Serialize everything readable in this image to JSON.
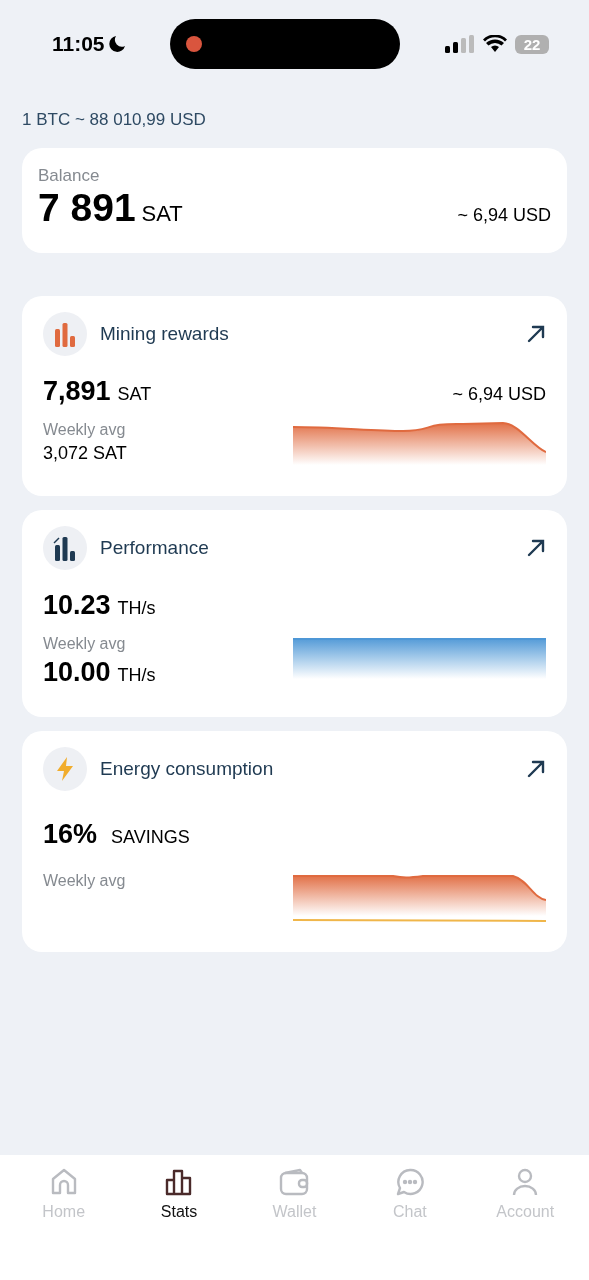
{
  "status_bar": {
    "time": "11:05",
    "battery": "22"
  },
  "rate": "1 BTC ~ 88 010,99 USD",
  "balance": {
    "label": "Balance",
    "value": "7 891",
    "unit": "SAT",
    "fiat": "~ 6,94 USD"
  },
  "cards": [
    {
      "kind": "rewards",
      "title": "Mining rewards",
      "value": "7,891",
      "unit": "SAT",
      "fiat": "~ 6,94 USD",
      "avg_label": "Weekly avg",
      "avg_value": "3,072 SAT"
    },
    {
      "kind": "performance",
      "title": "Performance",
      "value": "10.23",
      "unit": "TH/s",
      "avg_label": "Weekly avg",
      "avg_value": "10.00",
      "avg_unit": "TH/s"
    },
    {
      "kind": "energy",
      "title": "Energy consumption",
      "value": "16%",
      "unit": "SAVINGS",
      "avg_label": "Weekly avg"
    }
  ],
  "nav": [
    {
      "kind": "home",
      "label": "Home",
      "selected": false
    },
    {
      "kind": "stats",
      "label": "Stats",
      "selected": true
    },
    {
      "kind": "wallet",
      "label": "Wallet",
      "selected": false
    },
    {
      "kind": "chat",
      "label": "Chat",
      "selected": false
    },
    {
      "kind": "account",
      "label": "Account",
      "selected": false
    }
  ]
}
